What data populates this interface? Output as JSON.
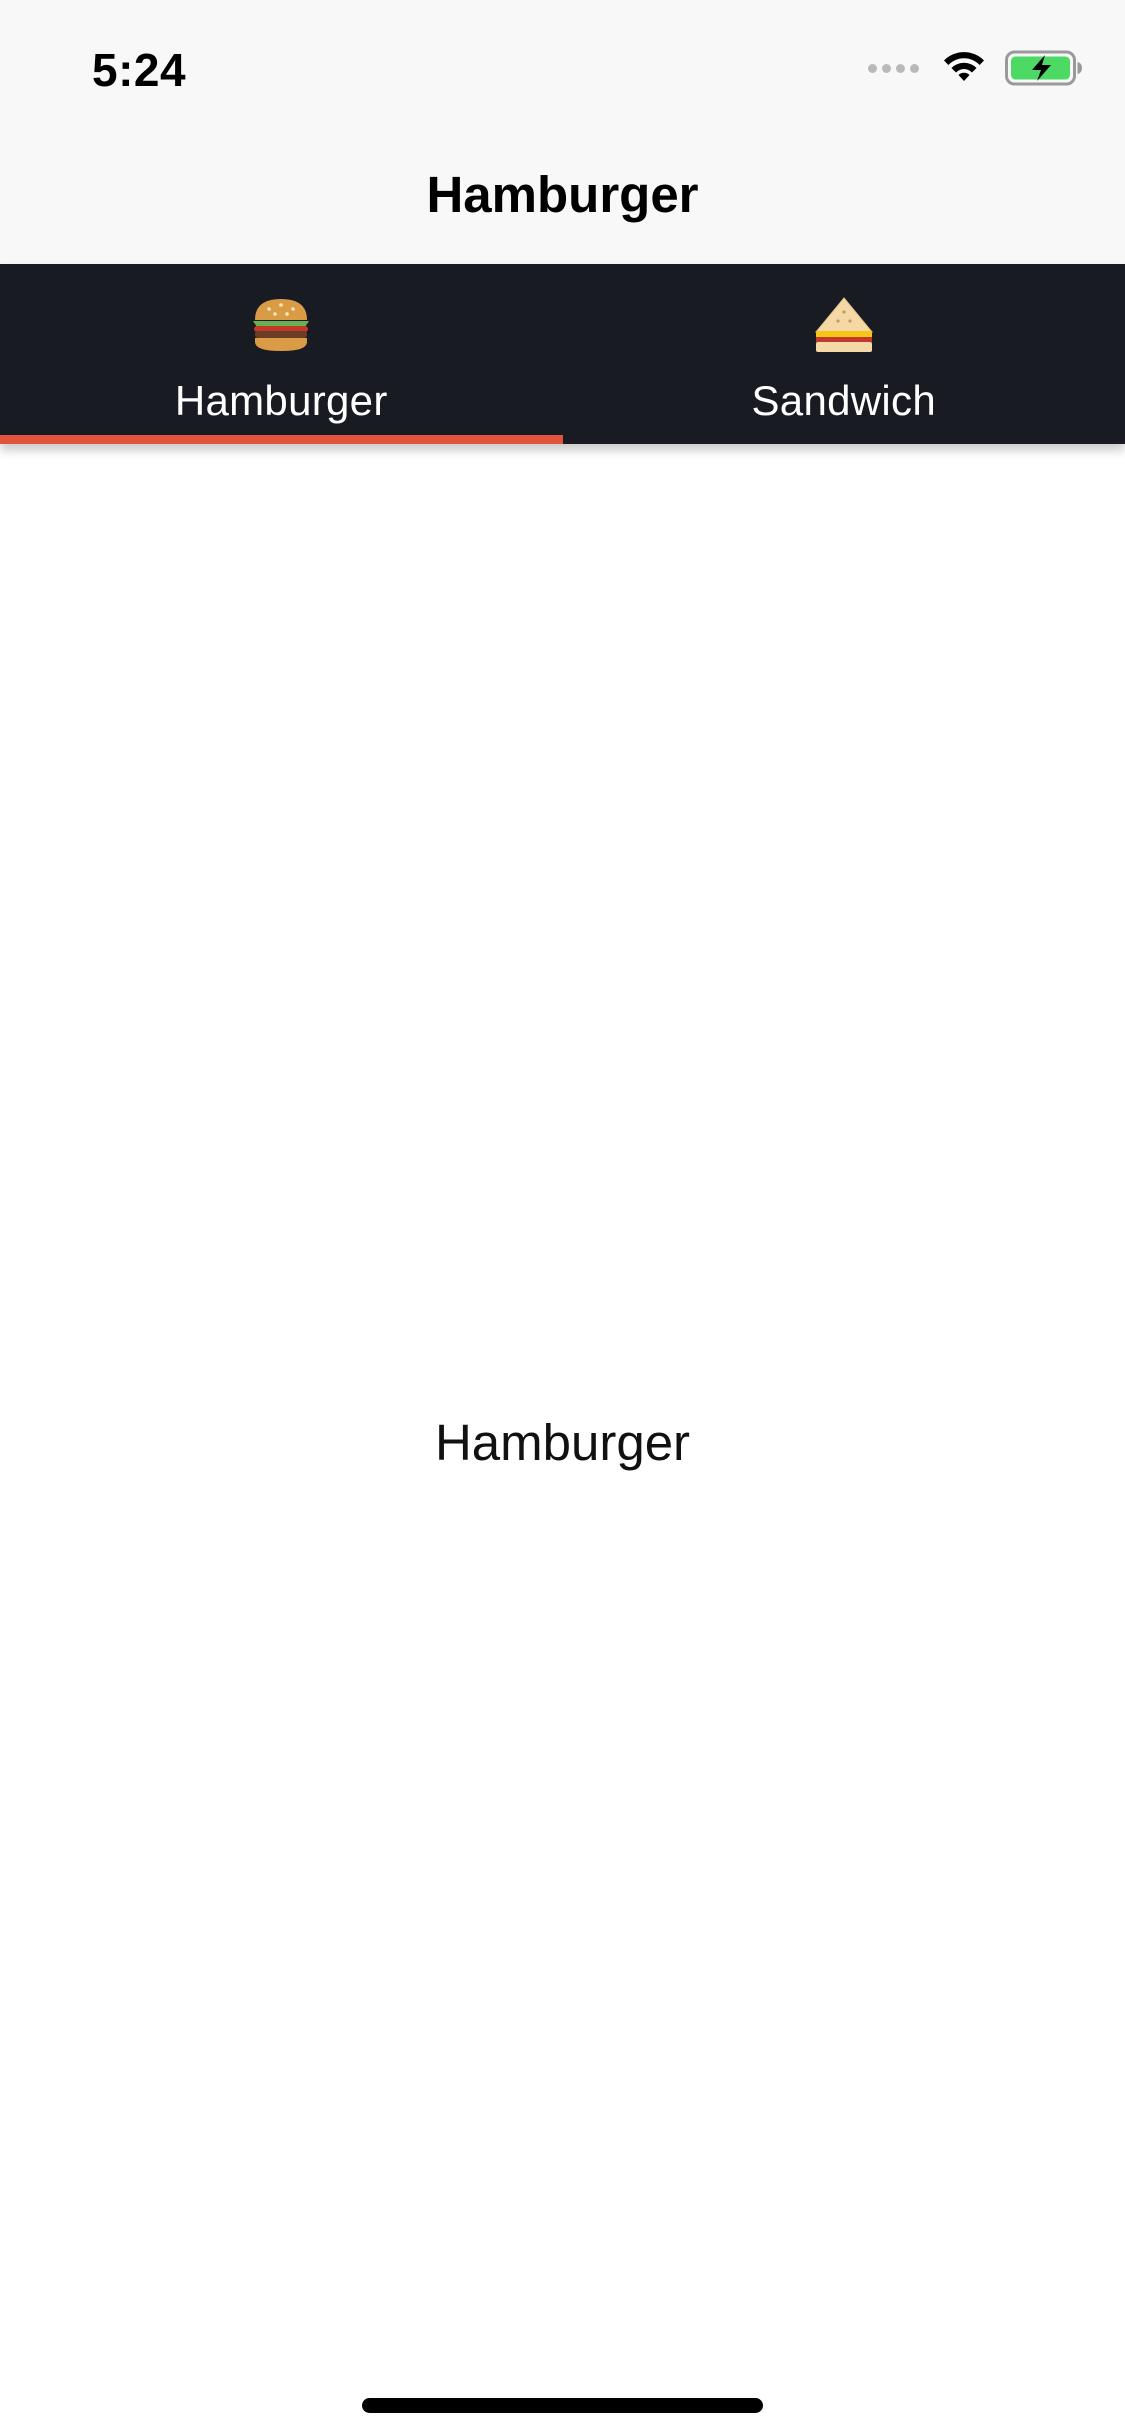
{
  "status_bar": {
    "time": "5:24",
    "icons": [
      "signal-dots-icon",
      "wifi-icon",
      "battery-charging-icon"
    ],
    "battery_color": "#4cd964"
  },
  "nav": {
    "title": "Hamburger"
  },
  "tabs": [
    {
      "label": "Hamburger",
      "icon": "hamburger-icon",
      "selected": true
    },
    {
      "label": "Sandwich",
      "icon": "sandwich-icon",
      "selected": false
    }
  ],
  "colors": {
    "tab_bar_bg": "#191b22",
    "indicator": "#e0533d",
    "header_bg": "#f8f8f8"
  },
  "content": {
    "text": "Hamburger"
  }
}
